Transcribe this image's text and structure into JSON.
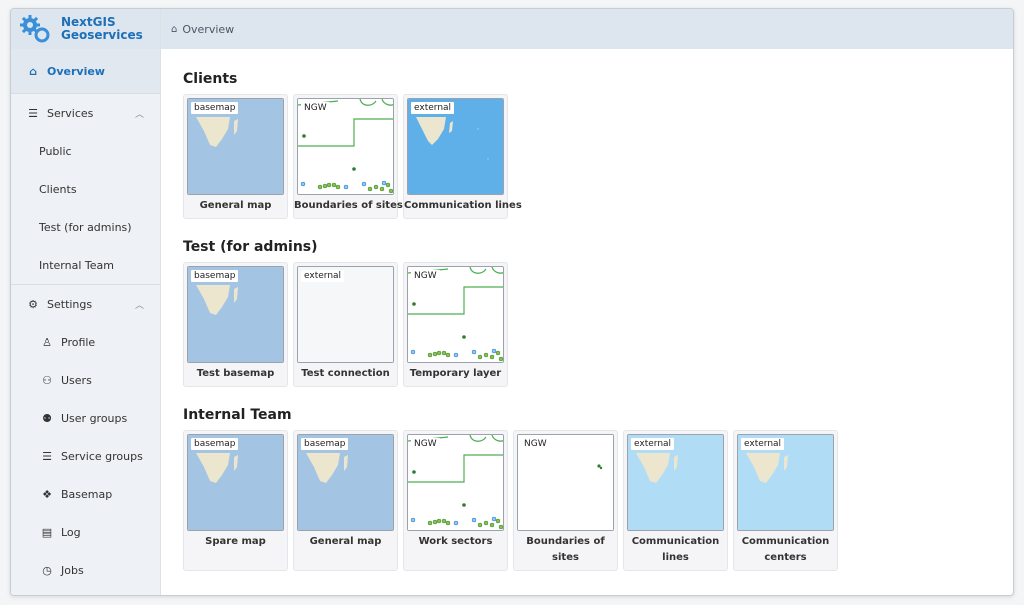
{
  "app": {
    "name_line1": "NextGIS",
    "name_line2": "Geoservices"
  },
  "breadcrumb": {
    "current": "Overview"
  },
  "sidebar": {
    "overview": "Overview",
    "services": {
      "label": "Services",
      "items": [
        "Public",
        "Clients",
        "Test (for admins)",
        "Internal Team"
      ]
    },
    "settings": {
      "label": "Settings",
      "items": [
        {
          "label": "Profile",
          "icon": "profile-icon"
        },
        {
          "label": "Users",
          "icon": "users-icon"
        },
        {
          "label": "User groups",
          "icon": "user-groups-icon"
        },
        {
          "label": "Service groups",
          "icon": "service-groups-icon"
        },
        {
          "label": "Basemap",
          "icon": "basemap-icon"
        },
        {
          "label": "Log",
          "icon": "log-icon"
        },
        {
          "label": "Jobs",
          "icon": "jobs-icon"
        }
      ]
    }
  },
  "sections": [
    {
      "title": "Clients",
      "cards": [
        {
          "tag": "basemap",
          "label": "General map",
          "thumb": "basemap"
        },
        {
          "tag": "NGW",
          "label": "Boundaries of sites",
          "thumb": "ngw-lines"
        },
        {
          "tag": "external",
          "label": "Communication lines",
          "thumb": "external-blue"
        }
      ]
    },
    {
      "title": "Test (for admins)",
      "cards": [
        {
          "tag": "basemap",
          "label": "Test basemap",
          "thumb": "basemap"
        },
        {
          "tag": "external",
          "label": "Test connection",
          "thumb": "empty"
        },
        {
          "tag": "NGW",
          "label": "Temporary layer",
          "thumb": "ngw-lines"
        }
      ]
    },
    {
      "title": "Internal Team",
      "cards": [
        {
          "tag": "basemap",
          "label": "Spare map",
          "thumb": "basemap"
        },
        {
          "tag": "basemap",
          "label": "General map",
          "thumb": "basemap"
        },
        {
          "tag": "NGW",
          "label": "Work sectors",
          "thumb": "ngw-lines"
        },
        {
          "tag": "NGW",
          "label": "Boundaries of sites",
          "thumb": "ngw-dots"
        },
        {
          "tag": "external",
          "label": "Communication lines",
          "thumb": "external-light"
        },
        {
          "tag": "external",
          "label": "Communication centers",
          "thumb": "external-light"
        }
      ]
    }
  ],
  "colors": {
    "accent": "#1d6fb8",
    "basemap_water": "#a3c5e3",
    "external_blue": "#5fb0e8",
    "external_light": "#b0dcf5",
    "land": "#ede6cf",
    "ngw_line": "#4caf50"
  }
}
